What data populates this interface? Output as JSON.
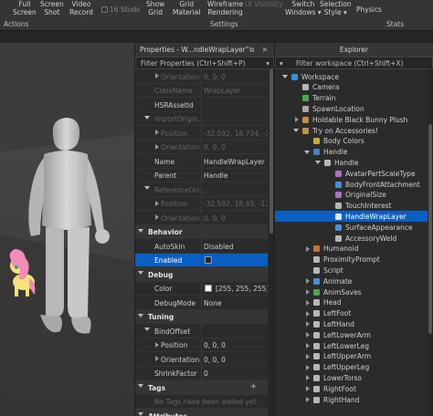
{
  "ribbon": {
    "full_screen": [
      "Full",
      "Screen"
    ],
    "screen_shot": [
      "Screen",
      "Shot"
    ],
    "video_record": [
      "Video",
      "Record"
    ],
    "studs": "16 Studs",
    "show_grid": [
      "Show",
      "Grid"
    ],
    "grid_material": [
      "Grid",
      "Material"
    ],
    "wireframe_rendering": [
      "Wireframe",
      "Rendering"
    ],
    "ui_visibility": "UI Visibility",
    "switch_windows": [
      "Switch",
      "Windows ▾"
    ],
    "selection_style": [
      "Selection",
      "Style ▾"
    ],
    "physics": "Physics",
    "sections": {
      "actions": "Actions",
      "settings": "Settings",
      "stats": "Stats"
    }
  },
  "properties": {
    "title": "Properties - W...ndleWrapLayer\"",
    "title_buttons": "⧉ ✕",
    "filter_placeholder": "Filter Properties (Ctrl+Shift+P)",
    "rows": [
      {
        "name": "Orientation",
        "value": "0, 0, 0",
        "state": "dim",
        "indent": 2,
        "arrow": "right"
      },
      {
        "name": "ClassName",
        "value": "WrapLayer",
        "state": "dim",
        "indent": 1
      },
      {
        "name": "HSRAssetId",
        "value": "",
        "state": "normal",
        "indent": 1
      },
      {
        "name": "ImportOrigin...",
        "value": "",
        "state": "dim",
        "indent": 1,
        "arrow": "down"
      },
      {
        "name": "Position",
        "value": "-32.592, 18.734, -3...",
        "state": "dim",
        "indent": 2,
        "arrow": "right"
      },
      {
        "name": "Orientation",
        "value": "0, 0, 0",
        "state": "dim",
        "indent": 2,
        "arrow": "right"
      },
      {
        "name": "Name",
        "value": "HandleWrapLayer",
        "state": "normal",
        "indent": 1
      },
      {
        "name": "Parent",
        "value": "Handle",
        "state": "normal",
        "indent": 1
      },
      {
        "name": "ReferenceOri...",
        "value": "",
        "state": "dim",
        "indent": 1,
        "arrow": "down"
      },
      {
        "name": "Position",
        "value": "-32.592, 18.49, -13...",
        "state": "dim",
        "indent": 2,
        "arrow": "right"
      },
      {
        "name": "Orientation",
        "value": "0, 0, 0",
        "state": "dim",
        "indent": 2,
        "arrow": "right"
      },
      {
        "name": "Behavior",
        "value": "",
        "state": "cat",
        "indent": 0,
        "arrow": "down"
      },
      {
        "name": "AutoSkin",
        "value": "Disabled",
        "state": "normal",
        "indent": 1
      },
      {
        "name": "Enabled",
        "value": "",
        "state": "sel",
        "indent": 1,
        "checkbox": true
      },
      {
        "name": "Debug",
        "value": "",
        "state": "cat",
        "indent": 0,
        "arrow": "down"
      },
      {
        "name": "Color",
        "value": "[255, 255, 255]",
        "state": "normal",
        "indent": 1,
        "swatch": true
      },
      {
        "name": "DebugMode",
        "value": "None",
        "state": "normal",
        "indent": 1
      },
      {
        "name": "Tuning",
        "value": "",
        "state": "cat",
        "indent": 0,
        "arrow": "down"
      },
      {
        "name": "BindOffset",
        "value": "",
        "state": "normal",
        "indent": 1,
        "arrow": "down"
      },
      {
        "name": "Position",
        "value": "0, 0, 0",
        "state": "normal",
        "indent": 2,
        "arrow": "right"
      },
      {
        "name": "Orientation",
        "value": "0, 0, 0",
        "state": "normal",
        "indent": 2,
        "arrow": "right"
      },
      {
        "name": "ShrinkFactor",
        "value": "0",
        "state": "normal",
        "indent": 1
      },
      {
        "name": "Tags",
        "value": "",
        "state": "cat",
        "indent": 0,
        "arrow": "down",
        "plus": "+"
      },
      {
        "name": "No Tags have been added yet",
        "value": "",
        "state": "dim",
        "indent": 1,
        "nosep": true
      },
      {
        "name": "Attributes",
        "value": "",
        "state": "cat",
        "indent": 0,
        "arrow": "down"
      }
    ]
  },
  "explorer": {
    "title": "Explorer",
    "filter_placeholder": "Filter workspace (Ctrl+Shift+X)",
    "rows": [
      {
        "label": "Workspace",
        "depth": 0,
        "toggle": "down",
        "icon": "workspace-icon",
        "color": "#3aa0ff"
      },
      {
        "label": "Camera",
        "depth": 1,
        "icon": "camera-icon",
        "color": "#cfcfcf"
      },
      {
        "label": "Terrain",
        "depth": 1,
        "icon": "terrain-icon",
        "color": "#4fbf5b"
      },
      {
        "label": "SpawnLocation",
        "depth": 1,
        "icon": "spawn-icon",
        "color": "#bfbfbf"
      },
      {
        "label": "Holdable Black Bunny Plush",
        "depth": 1,
        "toggle": "right",
        "icon": "model-icon",
        "color": "#e0a050"
      },
      {
        "label": "Try on Accessories!",
        "depth": 1,
        "toggle": "down",
        "icon": "model-icon",
        "color": "#e0a050"
      },
      {
        "label": "Body Colors",
        "depth": 2,
        "icon": "body-colors-icon",
        "color": "#e0c040"
      },
      {
        "label": "Handle",
        "depth": 2,
        "toggle": "down",
        "icon": "accessory-icon",
        "color": "#4a90e2"
      },
      {
        "label": "Handle",
        "depth": 3,
        "toggle": "down",
        "icon": "part-icon",
        "color": "#d0d0d0"
      },
      {
        "label": "AvatarPartScaleType",
        "depth": 4,
        "icon": "value-icon",
        "color": "#c080e0"
      },
      {
        "label": "BodyFrontAttachment",
        "depth": 4,
        "icon": "attachment-icon",
        "color": "#4fa0ff"
      },
      {
        "label": "OriginalSize",
        "depth": 4,
        "icon": "value-icon",
        "color": "#c080e0"
      },
      {
        "label": "TouchInterest",
        "depth": 4,
        "icon": "touch-icon",
        "color": "#d0d0d0"
      },
      {
        "label": "HandleWrapLayer",
        "depth": 4,
        "icon": "wrap-layer-icon",
        "color": "#ffffff",
        "selected": true
      },
      {
        "label": "SurfaceAppearance",
        "depth": 4,
        "icon": "surface-icon",
        "color": "#4fa0ff"
      },
      {
        "label": "AccessoryWeld",
        "depth": 4,
        "icon": "weld-icon",
        "color": "#d0d0d0"
      },
      {
        "label": "Humanoid",
        "depth": 2,
        "toggle": "right",
        "icon": "humanoid-icon",
        "color": "#e08040"
      },
      {
        "label": "ProximityPrompt",
        "depth": 2,
        "icon": "prompt-icon",
        "color": "#d0d0d0"
      },
      {
        "label": "Script",
        "depth": 2,
        "icon": "script-icon",
        "color": "#d0d0d0"
      },
      {
        "label": "Animate",
        "depth": 2,
        "toggle": "right",
        "icon": "script-icon",
        "color": "#4fa0ff"
      },
      {
        "label": "AnimSaves",
        "depth": 2,
        "toggle": "right",
        "icon": "anim-icon",
        "color": "#4fbf5b"
      },
      {
        "label": "Head",
        "depth": 2,
        "toggle": "right",
        "icon": "meshpart-icon",
        "color": "#d0d0d0"
      },
      {
        "label": "LeftFoot",
        "depth": 2,
        "toggle": "right",
        "icon": "meshpart-icon",
        "color": "#d0d0d0"
      },
      {
        "label": "LeftHand",
        "depth": 2,
        "toggle": "right",
        "icon": "meshpart-icon",
        "color": "#d0d0d0"
      },
      {
        "label": "LeftLowerArm",
        "depth": 2,
        "toggle": "right",
        "icon": "meshpart-icon",
        "color": "#d0d0d0"
      },
      {
        "label": "LeftLowerLeg",
        "depth": 2,
        "toggle": "right",
        "icon": "meshpart-icon",
        "color": "#d0d0d0"
      },
      {
        "label": "LeftUpperArm",
        "depth": 2,
        "toggle": "right",
        "icon": "meshpart-icon",
        "color": "#d0d0d0"
      },
      {
        "label": "LeftUpperLeg",
        "depth": 2,
        "toggle": "right",
        "icon": "meshpart-icon",
        "color": "#d0d0d0"
      },
      {
        "label": "LowerTorso",
        "depth": 2,
        "toggle": "right",
        "icon": "meshpart-icon",
        "color": "#d0d0d0"
      },
      {
        "label": "RightFoot",
        "depth": 2,
        "toggle": "right",
        "icon": "meshpart-icon",
        "color": "#d0d0d0"
      },
      {
        "label": "RightHand",
        "depth": 2,
        "toggle": "right",
        "icon": "meshpart-icon",
        "color": "#d0d0d0"
      }
    ]
  },
  "colors": {
    "selection": "#0a5fc2",
    "panel": "#2b2b2b",
    "header": "#363636"
  }
}
